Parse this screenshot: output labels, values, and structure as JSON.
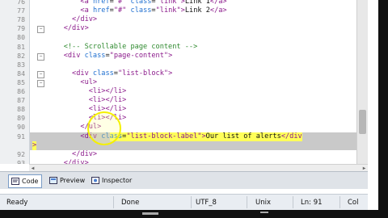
{
  "lines": [
    {
      "num": "76",
      "parts": [
        [
          "txt",
          "        "
        ],
        [
          "tag",
          "<a "
        ],
        [
          "attr",
          "href"
        ],
        [
          "txt",
          "="
        ],
        [
          "str",
          "\"#\""
        ],
        [
          "txt",
          " "
        ],
        [
          "attr",
          "class"
        ],
        [
          "txt",
          "="
        ],
        [
          "str",
          "\"link\""
        ],
        [
          "tag",
          ">"
        ],
        [
          "txt",
          "Link 1"
        ],
        [
          "tag",
          "</a>"
        ]
      ]
    },
    {
      "num": "77",
      "parts": [
        [
          "txt",
          "        "
        ],
        [
          "tag",
          "<a "
        ],
        [
          "attr",
          "href"
        ],
        [
          "txt",
          "="
        ],
        [
          "str",
          "\"#\""
        ],
        [
          "txt",
          " "
        ],
        [
          "attr",
          "class"
        ],
        [
          "txt",
          "="
        ],
        [
          "str",
          "\"link\""
        ],
        [
          "tag",
          ">"
        ],
        [
          "txt",
          "Link 2"
        ],
        [
          "tag",
          "</a>"
        ]
      ]
    },
    {
      "num": "78",
      "parts": [
        [
          "txt",
          "      "
        ],
        [
          "tag",
          "</div>"
        ]
      ]
    },
    {
      "num": "79",
      "parts": [
        [
          "txt",
          "    "
        ],
        [
          "tag",
          "</div>"
        ]
      ]
    },
    {
      "num": "80",
      "parts": []
    },
    {
      "num": "81",
      "parts": [
        [
          "cmt",
          "    <!-- Scrollable page content -->"
        ]
      ]
    },
    {
      "num": "82",
      "parts": [
        [
          "txt",
          "    "
        ],
        [
          "tag",
          "<div "
        ],
        [
          "attr",
          "class"
        ],
        [
          "txt",
          "="
        ],
        [
          "str",
          "\"page-content\""
        ],
        [
          "tag",
          ">"
        ]
      ]
    },
    {
      "num": "83",
      "parts": []
    },
    {
      "num": "84",
      "parts": [
        [
          "txt",
          "      "
        ],
        [
          "tag",
          "<div "
        ],
        [
          "attr",
          "class"
        ],
        [
          "txt",
          "="
        ],
        [
          "str",
          "\"list-block\""
        ],
        [
          "tag",
          ">"
        ]
      ]
    },
    {
      "num": "85",
      "parts": [
        [
          "txt",
          "        "
        ],
        [
          "tag",
          "<ul>"
        ]
      ]
    },
    {
      "num": "86",
      "parts": [
        [
          "txt",
          "          "
        ],
        [
          "tag",
          "<li></li>"
        ]
      ]
    },
    {
      "num": "87",
      "parts": [
        [
          "txt",
          "          "
        ],
        [
          "tag",
          "<li></li>"
        ]
      ]
    },
    {
      "num": "88",
      "parts": [
        [
          "txt",
          "          "
        ],
        [
          "tag",
          "<li></li>"
        ]
      ]
    },
    {
      "num": "89",
      "parts": [
        [
          "txt",
          "          "
        ],
        [
          "tag",
          "<li></li>"
        ]
      ]
    },
    {
      "num": "90",
      "parts": [
        [
          "txt",
          "        "
        ],
        [
          "tag",
          "</ul>"
        ]
      ]
    },
    {
      "num": "91",
      "parts": [
        [
          "txt",
          "        "
        ],
        [
          "tag",
          "<div "
        ],
        [
          "attr",
          "class"
        ],
        [
          "txt",
          "="
        ],
        [
          "str",
          "\"list-block-label\""
        ],
        [
          "tag",
          ">"
        ],
        [
          "txt",
          "Our list of alerts"
        ],
        [
          "tag",
          "</div"
        ]
      ]
    },
    {
      "num": "",
      "parts": [
        [
          "tag",
          ">"
        ]
      ]
    },
    {
      "num": "92",
      "parts": [
        [
          "txt",
          "      "
        ],
        [
          "tag",
          "</div>"
        ]
      ]
    },
    {
      "num": "93",
      "parts": [
        [
          "txt",
          "    "
        ],
        [
          "tag",
          "</div>"
        ]
      ]
    }
  ],
  "tabs": [
    {
      "label": "Code",
      "icon": "code-view-icon"
    },
    {
      "label": "Preview",
      "icon": "preview-icon"
    },
    {
      "label": "Inspector",
      "icon": "inspector-icon"
    }
  ],
  "status": {
    "ready": "Ready",
    "done": "Done",
    "encoding": "UTF_8",
    "line_endings": "Unix",
    "line": "Ln: 91",
    "col": "Col"
  }
}
